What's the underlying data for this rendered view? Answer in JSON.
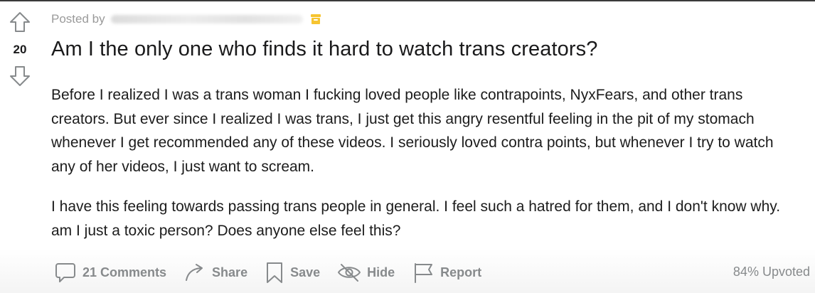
{
  "post": {
    "posted_by_label": "Posted by",
    "score": "20",
    "title": "Am I the only one who finds it hard to watch trans creators?",
    "body": [
      "Before I realized I was a trans woman I fucking loved people like contrapoints, NyxFears, and other trans creators. But ever since I realized I was trans, I just get this angry resentful feeling in the pit of my stomach whenever I get recommended any of these videos. I seriously loved contra points, but whenever I try to watch any of her videos, I just want to scream.",
      "I have this feeling towards passing trans people in general. I feel such a hatred for them, and I don't know why. am I just a toxic person? Does anyone else feel this?"
    ]
  },
  "actions": {
    "comments_label": "21 Comments",
    "share_label": "Share",
    "save_label": "Save",
    "hide_label": "Hide",
    "report_label": "Report"
  },
  "upvoted_label": "84% Upvoted",
  "icons": {
    "upvote": "upvote-arrow-icon",
    "downvote": "downvote-arrow-icon",
    "archive": "archive-icon",
    "comments": "comment-bubble-icon",
    "share": "share-arrow-icon",
    "save": "bookmark-icon",
    "hide": "eye-slash-icon",
    "report": "flag-icon"
  },
  "colors": {
    "archive_icon": "#f6c430",
    "action_gray": "#878a8c",
    "text": "#1a1a1b"
  }
}
